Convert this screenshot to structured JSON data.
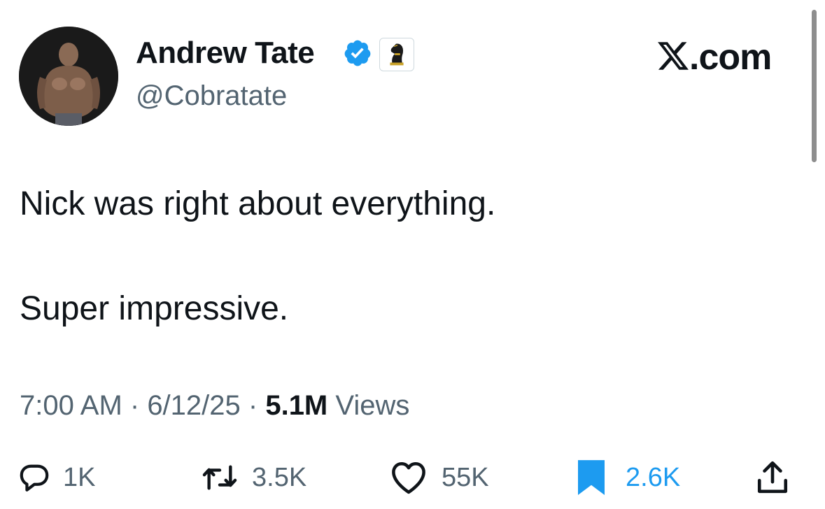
{
  "author": {
    "name": "Andrew Tate",
    "handle": "@Cobratate",
    "verified": true,
    "affiliate_badge_icon": "chess-knight-icon"
  },
  "site": {
    "label": ".com",
    "logo_icon": "x-logo-icon"
  },
  "tweet": {
    "lines": [
      "Nick was right about everything.",
      "Super impressive."
    ]
  },
  "meta": {
    "time": "7:00 AM",
    "sep1": " · ",
    "date": "6/12/25",
    "sep2": " · ",
    "views_count": "5.1M",
    "views_label": " Views"
  },
  "actions": {
    "replies": "1K",
    "reposts": "3.5K",
    "likes": "55K",
    "bookmarks": "2.6K"
  },
  "colors": {
    "accent": "#1d9bf0",
    "text": "#0f1419",
    "secondary": "#536471"
  }
}
